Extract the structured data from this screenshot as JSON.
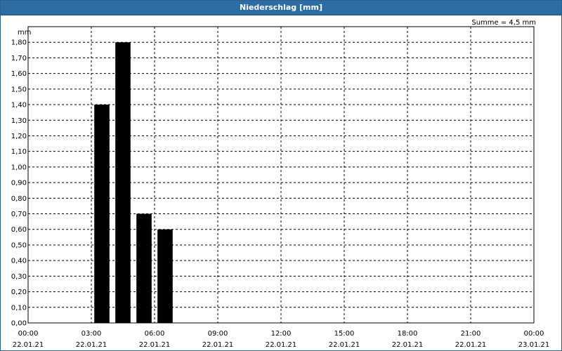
{
  "window": {
    "title": "Niederschlag [mm]"
  },
  "summary": "Summe = 4,5 mm",
  "colors": {
    "titlebar": "#2e6da4",
    "bar": "#000000",
    "grid": "#000000"
  },
  "chart_data": {
    "type": "bar",
    "title": "Niederschlag [mm]",
    "ylabel": "mm",
    "xlabel": "",
    "ylim": [
      0,
      1.9
    ],
    "grid": true,
    "y_ticks": [
      "0,00",
      "0,10",
      "0,20",
      "0,30",
      "0,40",
      "0,50",
      "0,60",
      "0,70",
      "0,80",
      "0,90",
      "1,00",
      "1,10",
      "1,20",
      "1,30",
      "1,40",
      "1,50",
      "1,60",
      "1,70",
      "1,80"
    ],
    "x_ticks": [
      {
        "time": "00:00",
        "date": "22.01.21"
      },
      {
        "time": "03:00",
        "date": "22.01.21"
      },
      {
        "time": "06:00",
        "date": "22.01.21"
      },
      {
        "time": "09:00",
        "date": "22.01.21"
      },
      {
        "time": "12:00",
        "date": "22.01.21"
      },
      {
        "time": "15:00",
        "date": "22.01.21"
      },
      {
        "time": "18:00",
        "date": "22.01.21"
      },
      {
        "time": "21:00",
        "date": "22.01.21"
      },
      {
        "time": "00:00",
        "date": "23.01.21"
      }
    ],
    "x_range_hours": [
      0,
      24
    ],
    "bars": [
      {
        "start_hour": 3,
        "end_hour": 4,
        "value": 1.4
      },
      {
        "start_hour": 4,
        "end_hour": 5,
        "value": 1.8
      },
      {
        "start_hour": 5,
        "end_hour": 6,
        "value": 0.7
      },
      {
        "start_hour": 6,
        "end_hour": 7,
        "value": 0.6
      }
    ]
  }
}
